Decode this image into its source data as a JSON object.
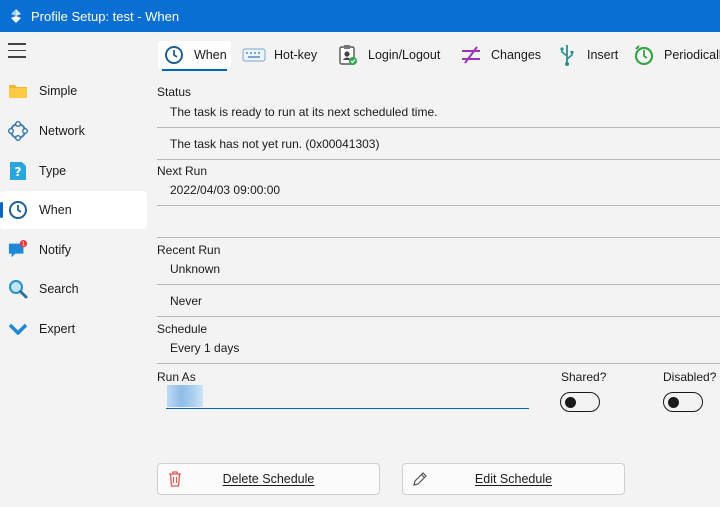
{
  "window": {
    "title": "Profile Setup: test - When"
  },
  "sidebar": {
    "items": [
      {
        "label": "Simple",
        "icon": "folder-icon"
      },
      {
        "label": "Network",
        "icon": "network-icon"
      },
      {
        "label": "Type",
        "icon": "help-icon"
      },
      {
        "label": "When",
        "icon": "clock-icon",
        "active": true
      },
      {
        "label": "Notify",
        "icon": "chat-notify-icon",
        "badge": "1"
      },
      {
        "label": "Search",
        "icon": "search-icon"
      },
      {
        "label": "Expert",
        "icon": "chevron-down-icon"
      }
    ]
  },
  "tabs": [
    {
      "label": "When",
      "icon": "clock-icon",
      "active": true
    },
    {
      "label": "Hot-key",
      "icon": "keyboard-icon"
    },
    {
      "label": "Login/Logout",
      "icon": "badge-user-icon"
    },
    {
      "label": "Changes",
      "icon": "changes-icon"
    },
    {
      "label": "Insert",
      "icon": "usb-icon"
    },
    {
      "label": "Periodically",
      "icon": "timer-icon"
    }
  ],
  "status": {
    "label": "Status",
    "line1": "The task is ready to run at its next scheduled time.",
    "line2": "The task has not yet run. (0x00041303)"
  },
  "next_run": {
    "label": "Next Run",
    "value": "2022/04/03 09:00:00",
    "value2": ""
  },
  "recent_run": {
    "label": "Recent Run",
    "line1": "Unknown",
    "line2": "Never"
  },
  "schedule": {
    "label": "Schedule",
    "value": "Every 1 days"
  },
  "run_as": {
    "label": "Run As",
    "value": ""
  },
  "toggles": {
    "shared": {
      "label": "Shared?",
      "on": false
    },
    "disabled": {
      "label": "Disabled?",
      "on": false
    }
  },
  "buttons": {
    "delete": "Delete Schedule",
    "edit": "Edit Schedule"
  },
  "colors": {
    "titlebar": "#0a6fd4",
    "accent": "#0067c0"
  }
}
